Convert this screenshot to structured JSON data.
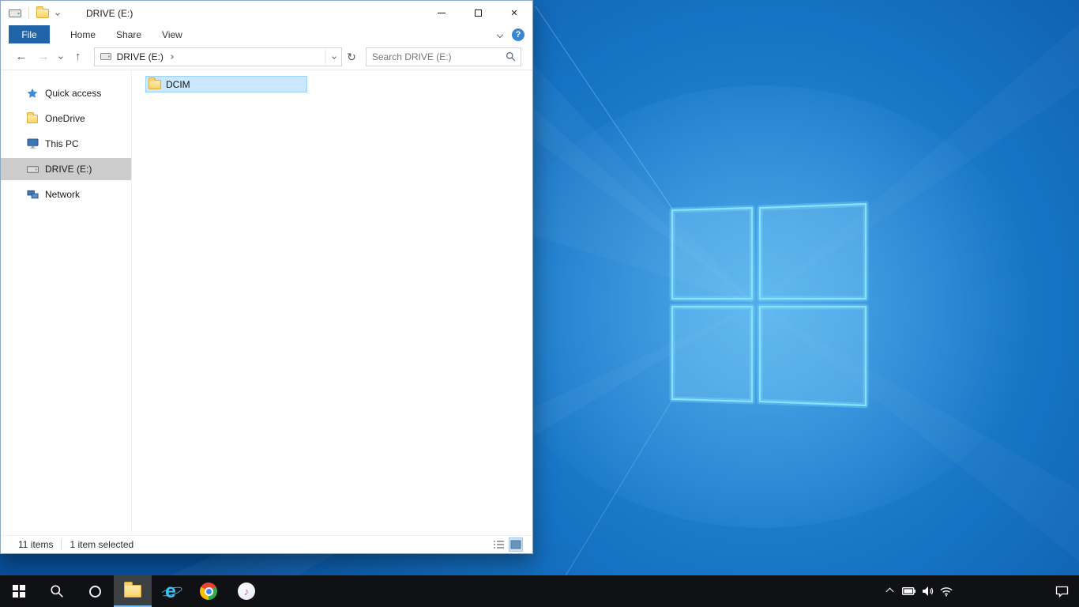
{
  "window": {
    "title": "DRIVE (E:)"
  },
  "ribbon": {
    "tabs": [
      "File",
      "Home",
      "Share",
      "View"
    ]
  },
  "address": {
    "location": "DRIVE (E:)"
  },
  "search": {
    "placeholder": "Search DRIVE (E:)"
  },
  "sidebar": {
    "items": [
      {
        "label": "Quick access",
        "icon": "star-icon",
        "selected": false
      },
      {
        "label": "OneDrive",
        "icon": "onedrive-icon",
        "selected": false
      },
      {
        "label": "This PC",
        "icon": "computer-icon",
        "selected": false
      },
      {
        "label": "DRIVE (E:)",
        "icon": "drive-icon",
        "selected": true
      },
      {
        "label": "Network",
        "icon": "network-icon",
        "selected": false
      }
    ]
  },
  "content": {
    "items": [
      {
        "name": "DCIM",
        "icon": "folder-icon",
        "selected": true
      }
    ]
  },
  "statusbar": {
    "items_text": "11 items",
    "selection_text": "1 item selected"
  },
  "icons": {
    "close": "×",
    "back": "←",
    "forward": "→",
    "up": "↑",
    "refresh": "↻",
    "help": "?",
    "ie_letter": "e",
    "itunes_note": "♪"
  },
  "colors": {
    "selection_fill": "#cce8ff",
    "selection_border": "#99d1ff",
    "sidebar_selected": "#cccccc",
    "file_tab_blue": "#2165a8",
    "taskbar_black": "#101114",
    "wallpaper_blue": "#1571c2",
    "folder_yellow": "#f8d468"
  },
  "taskbar": {
    "buttons": [
      {
        "name": "start",
        "icon": "windows-logo-icon",
        "active": false
      },
      {
        "name": "search",
        "icon": "search-icon",
        "active": false
      },
      {
        "name": "cortana",
        "icon": "cortana-icon",
        "active": false
      },
      {
        "name": "file-explorer",
        "icon": "file-explorer-icon",
        "active": true
      },
      {
        "name": "internet-explorer",
        "icon": "ie-icon",
        "active": false
      },
      {
        "name": "chrome",
        "icon": "chrome-icon",
        "active": false
      },
      {
        "name": "itunes",
        "icon": "itunes-icon",
        "active": false
      }
    ],
    "tray": [
      {
        "name": "hidden-icons",
        "icon": "chevron-up-icon"
      },
      {
        "name": "battery",
        "icon": "battery-icon"
      },
      {
        "name": "volume",
        "icon": "speaker-icon"
      },
      {
        "name": "network",
        "icon": "wifi-icon"
      },
      {
        "name": "action-center",
        "icon": "action-center-icon"
      }
    ]
  }
}
